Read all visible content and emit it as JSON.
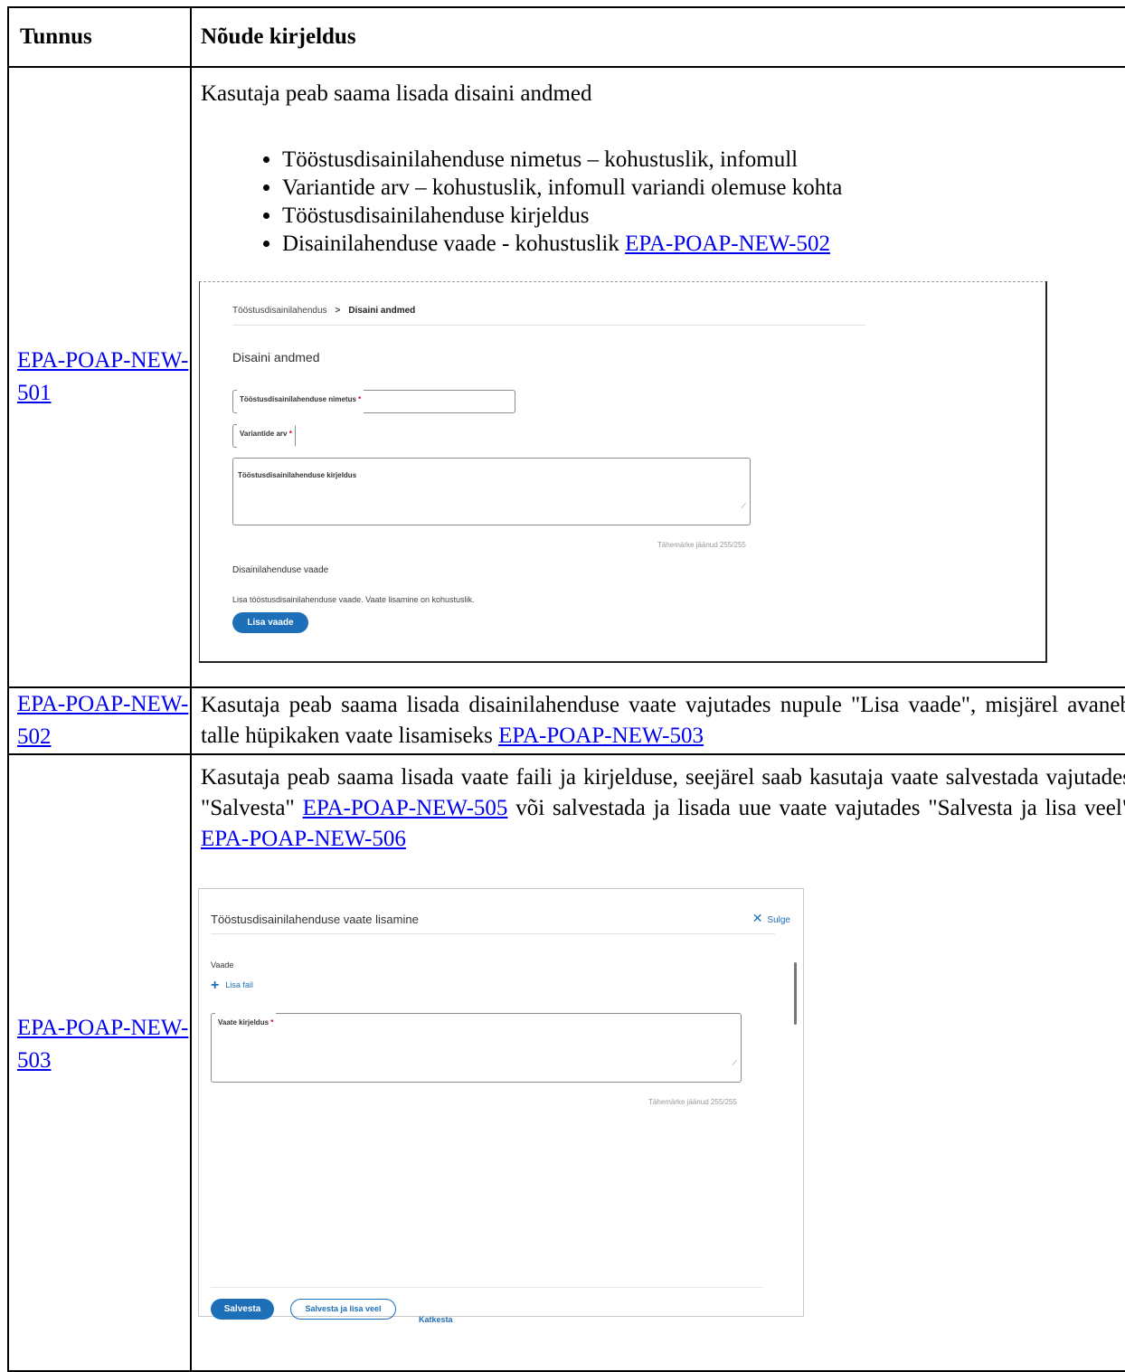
{
  "table": {
    "header_id": "Tunnus",
    "header_desc": "Nõude kirjeldus"
  },
  "rows": [
    {
      "id": "EPA-POAP-NEW-501",
      "intro": "Kasutaja peab saama lisada disaini andmed",
      "bullets": [
        "Tööstusdisainilahenduse nimetus – kohustuslik, infomull",
        "Variantide arv – kohustuslik, infomull variandi olemuse kohta",
        "Tööstusdisainilahenduse kirjeldus",
        "Disainilahenduse vaade - kohustuslik "
      ],
      "bullet_link": "EPA-POAP-NEW-502"
    },
    {
      "id": "EPA-POAP-NEW-502",
      "text": "Kasutaja peab saama lisada disainilahenduse vaate vajutades nupule \"Lisa vaade\", misjärel avaneb talle hüpikaken vaate lisamiseks ",
      "link": "EPA-POAP-NEW-503"
    },
    {
      "id": "EPA-POAP-NEW-503",
      "text_a": "Kasutaja peab saama lisada vaate faili ja kirjelduse, seejärel saab kasutaja vaate salvestada vajutades \"Salvesta\" ",
      "link_a": "EPA-POAP-NEW-505",
      "text_b": " või salvestada ja lisada uue vaate vajutades \"Salvesta ja lisa veel\" ",
      "link_b": "EPA-POAP-NEW-506"
    }
  ],
  "form_screenshot": {
    "breadcrumb_parent": "Tööstusdisainilahendus",
    "breadcrumb_separator": ">",
    "breadcrumb_current": "Disaini andmed",
    "title": "Disaini andmed",
    "field_name_label": "Tööstusdisainilahenduse nimetus",
    "field_variants_label": "Variantide arv",
    "field_description_label": "Tööstusdisainilahenduse kirjeldus",
    "required_mark": "*",
    "char_counter": "Tähemärke jäänud 255/255",
    "view_section_label": "Disainilahenduse vaade",
    "view_hint": "Lisa tööstusdisainilahenduse vaade. Vaate lisamine on kohustuslik.",
    "add_view_button": "Lisa vaade"
  },
  "modal_screenshot": {
    "title": "Tööstusdisainilahenduse vaate lisamine",
    "close_label": "Sulge",
    "view_label": "Vaade",
    "add_file": "Lisa fail",
    "description_label": "Vaate kirjeldus",
    "required_mark": "*",
    "char_counter": "Tähemärke jäänud 255/255",
    "save_button": "Salvesta",
    "save_add_button": "Salvesta ja lisa veel",
    "cancel_button": "Katkesta"
  },
  "colors": {
    "link": "#0000ee",
    "primary": "#1d6fb8",
    "required": "#d0021b"
  }
}
